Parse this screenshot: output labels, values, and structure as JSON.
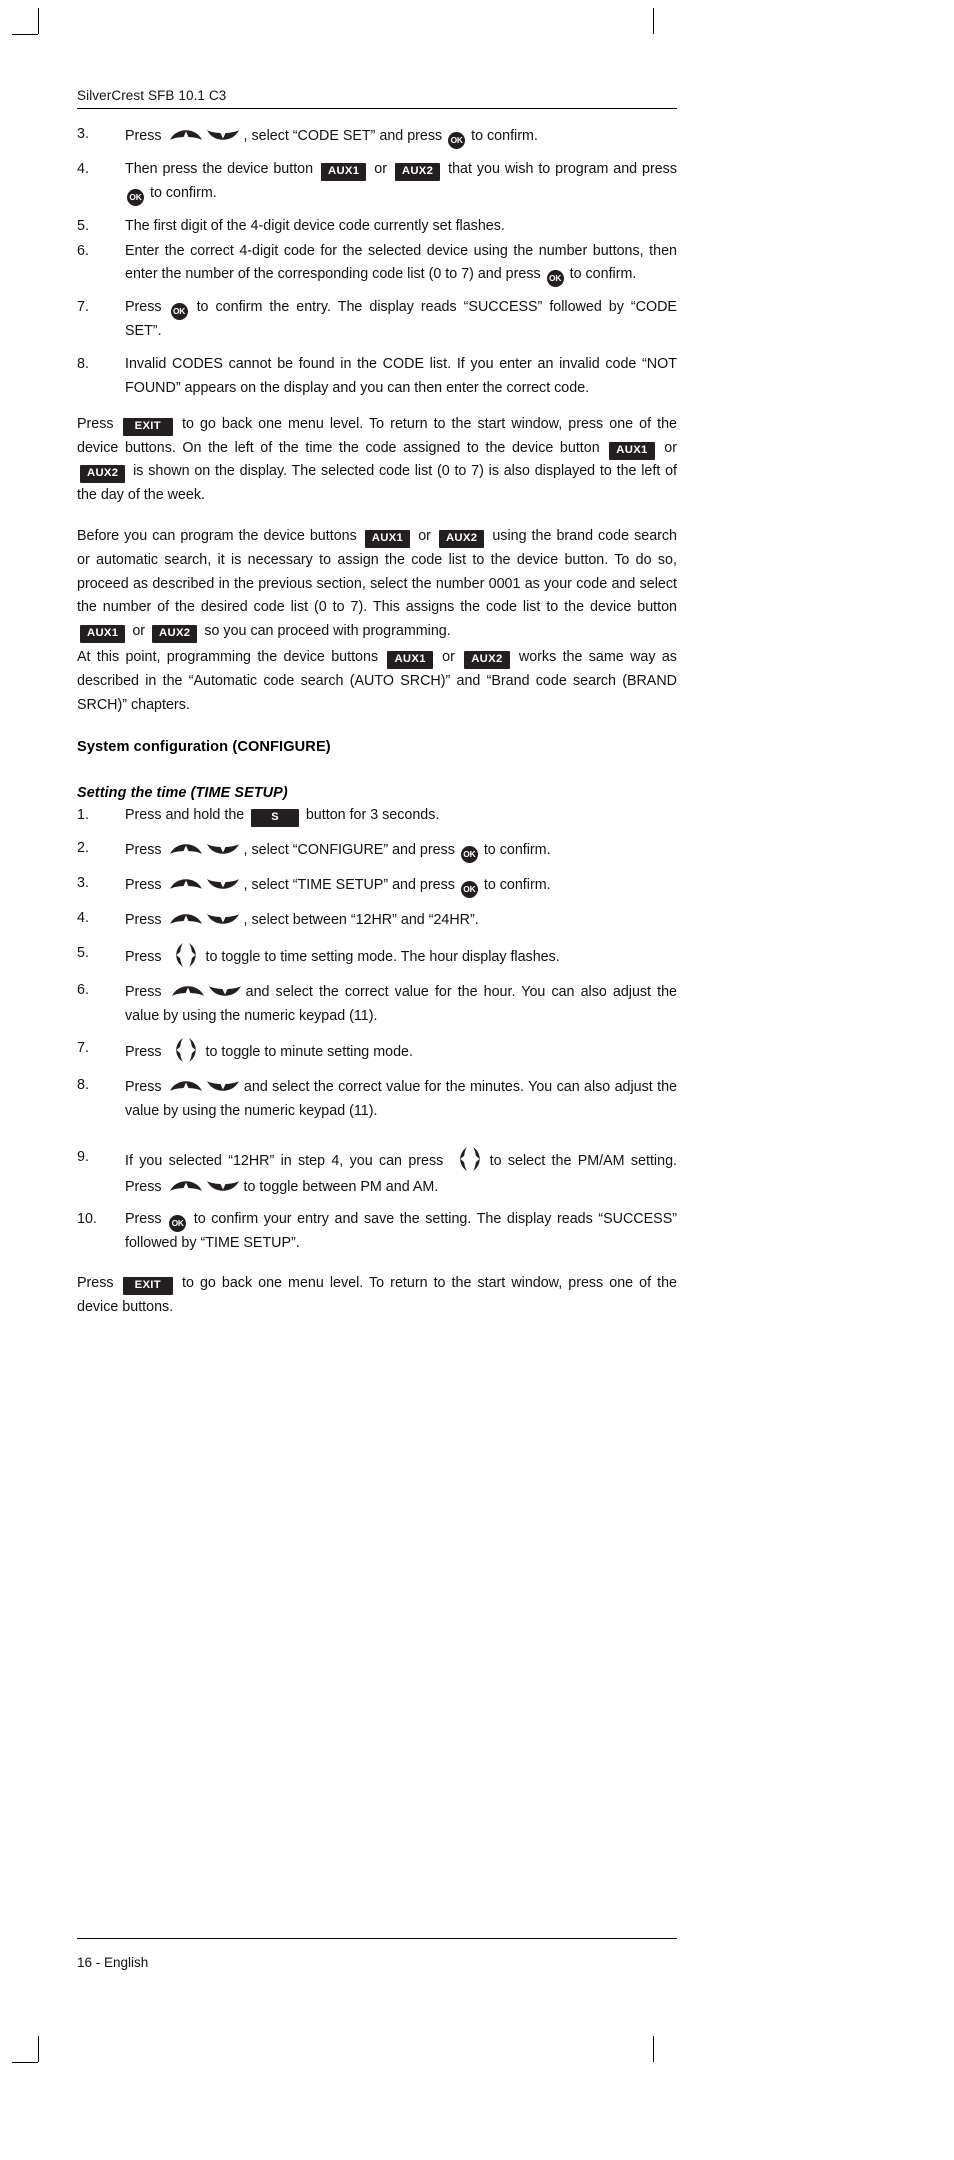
{
  "document": {
    "running_head": "SilverCrest SFB 10.1 C3",
    "page_footer": "16 - English"
  },
  "icons": {
    "ok": "OK",
    "aux1": "AUX1",
    "aux2": "AUX2",
    "exit": "EXIT",
    "s": "S"
  },
  "code_set_steps": {
    "s3": {
      "num": "3.",
      "t1": "Press",
      "t2": ", select “CODE SET” and press",
      "t3": "to confirm."
    },
    "s4": {
      "num": "4.",
      "t1": "Then press the device button",
      "t2": "or",
      "t3": "that you wish to program and press",
      "t4": "to confirm."
    },
    "s5": {
      "num": "5.",
      "t1": "The first digit of the 4-digit device code currently set flashes."
    },
    "s6": {
      "num": "6.",
      "t1": "Enter the correct 4-digit code for the selected device using the number buttons, then enter the number of the corresponding code list (0 to 7) and press",
      "t2": "to confirm."
    },
    "s7": {
      "num": "7.",
      "t1": "Press",
      "t2": "to confirm the entry. The display reads “SUCCESS” followed by “CODE SET”."
    },
    "s8": {
      "num": "8.",
      "t1": "Invalid CODES cannot be found in the CODE list. If you enter an invalid code “NOT FOUND” appears on the display and you can then enter the correct code."
    }
  },
  "exit_paragraph_1": {
    "t1": "Press",
    "t2": "to go back one menu level. To return to the start window, press one of the device buttons. On the left of the time the code assigned to the device button",
    "t3": "or",
    "t4": "is shown on the display. The selected code list (0 to 7) is also displayed to the left of the day of the week."
  },
  "before_paragraph": {
    "t1": "Before you can program the device buttons",
    "t2": "or",
    "t3": "using the brand code search or automatic search, it is necessary to assign the code list to the device button. To do so, proceed as described in the previous section, select the number 0001 as your code and select the number of the desired code list (0 to 7). This assigns the code list to the device button",
    "t4": "or",
    "t5": "so you can proceed with programming."
  },
  "atthispoint_paragraph": {
    "t1": "At this point, programming the device buttons",
    "t2": "or",
    "t3": "works the same way as described in the “Automatic code search (AUTO SRCH)” and “Brand code search (BRAND SRCH)” chapters."
  },
  "headings": {
    "system_configuration": "System configuration (CONFIGURE)",
    "setting_the_time": "Setting the time (TIME SETUP)"
  },
  "time_setup_steps": {
    "s1": {
      "num": "1.",
      "t1": "Press and hold the",
      "t2": "button for 3 seconds."
    },
    "s2": {
      "num": "2.",
      "t1": "Press",
      "t2": ", select “CONFIGURE” and press",
      "t3": "to confirm."
    },
    "s3": {
      "num": "3.",
      "t1": "Press",
      "t2": ", select “TIME SETUP” and press",
      "t3": "to confirm."
    },
    "s4": {
      "num": "4.",
      "t1": "Press",
      "t2": ", select between “12HR” and “24HR”."
    },
    "s5": {
      "num": "5.",
      "t1": "Press",
      "t2": "to toggle to time setting mode. The hour display flashes."
    },
    "s6": {
      "num": "6.",
      "t1": "Press",
      "t2": "and select the correct value for the hour. You can also adjust the value by using the numeric keypad (11)."
    },
    "s7": {
      "num": "7.",
      "t1": "Press",
      "t2": "to toggle to minute setting mode."
    },
    "s8": {
      "num": "8.",
      "t1": "Press",
      "t2": "and select the correct value for the minutes. You can also adjust the value by using the numeric keypad (11)."
    },
    "s9": {
      "num": "9.",
      "t1": "If you selected “12HR” in step 4,  you can press",
      "t2": "to select the PM/AM setting. Press",
      "t3": "to toggle between PM and AM."
    },
    "s10": {
      "num": "10.",
      "t1": "Press",
      "t2": "to confirm your entry and save the setting. The display reads “SUCCESS” followed by “TIME SETUP”."
    }
  },
  "exit_paragraph_2": {
    "t1": "Press",
    "t2": "to go back one menu level. To return to the start window, press one of the device buttons."
  }
}
